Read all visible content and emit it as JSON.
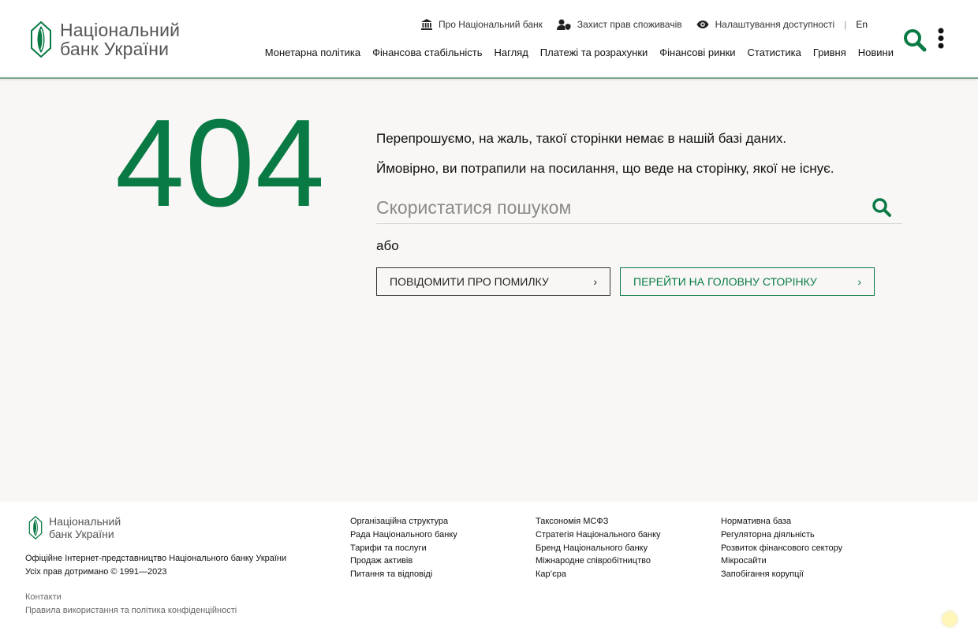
{
  "header": {
    "logo": {
      "line1": "Національний",
      "line2": "банк України"
    },
    "top_links": [
      {
        "label": "Про Національний банк",
        "icon": "bank-icon"
      },
      {
        "label": "Захист прав споживачів",
        "icon": "user-shield-icon"
      },
      {
        "label": "Налаштування доступності",
        "icon": "eye-icon"
      }
    ],
    "lang": "En",
    "main_nav": [
      "Монетарна політика",
      "Фінансова стабільність",
      "Нагляд",
      "Платежі та розрахунки",
      "Фінансові ринки",
      "Статистика",
      "Гривня",
      "Новини"
    ]
  },
  "main": {
    "error_code": "404",
    "message1": "Перепрошуємо, на жаль, такої сторінки немає в нашій базі даних.",
    "message2": "Ймовірно, ви потрапили на посилання, що веде на сторінку, якої не існує.",
    "search_placeholder": "Скористатися пошуком",
    "or_text": "або",
    "btn_report": "ПОВІДОМИТИ ПРО ПОМИЛКУ",
    "btn_home": "ПЕРЕЙТИ НА ГОЛОВНУ СТОРІНКУ"
  },
  "footer": {
    "logo": {
      "line1": "Національний",
      "line2": "банк України"
    },
    "official": "Офіційне Інтернет-представництво Національного банку України",
    "rights": "Усіх прав дотримано © 1991—2023",
    "contacts": "Контакти",
    "privacy": "Правила використання та політика конфіденційності",
    "col1": [
      "Організаційна структура",
      "Рада Національного банку",
      "Тарифи та послуги",
      "Продаж активів",
      "Питання та відповіді"
    ],
    "col2": [
      "Таксономія МСФЗ",
      "Стратегія Національного банку",
      "Бренд Національного банку",
      "Міжнародне співробітництво",
      "Кар’єра"
    ],
    "col3": [
      "Нормативна база",
      "Регуляторна діяльність",
      "Розвиток фінансового сектору",
      "Мікросайти",
      "Запобігання корупції"
    ]
  },
  "colors": {
    "brand_green": "#0a7a45",
    "background": "#f8f7f5"
  }
}
